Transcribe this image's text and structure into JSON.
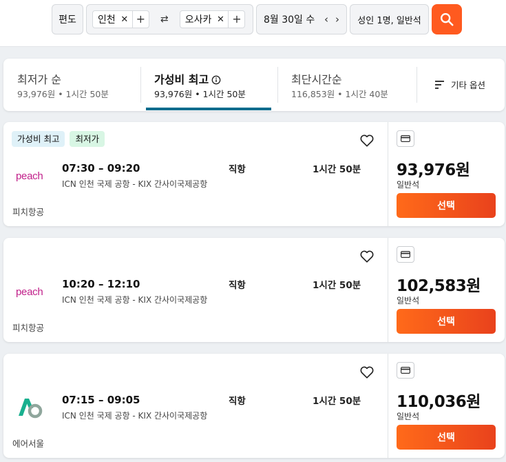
{
  "search": {
    "trip_type": "편도",
    "origin": "인천",
    "destination": "오사카",
    "remove_glyph": "✕",
    "add_glyph": "+",
    "swap_glyph": "⇄",
    "date": "8월 30일 수",
    "prev_glyph": "‹",
    "next_glyph": "›",
    "passengers": "성인 1명, 일반석",
    "accent_color": "#ff5a1f"
  },
  "sort_tabs": [
    {
      "title": "최저가 순",
      "subtitle": "93,976원 • 1시간 50분",
      "active": false
    },
    {
      "title": "가성비 최고",
      "subtitle": "93,976원 • 1시간 50분",
      "active": true
    },
    {
      "title": "최단시간순",
      "subtitle": "116,853원 • 1시간 40분",
      "active": false
    }
  ],
  "other_options": {
    "label": "기타 옵션",
    "icon": "sort-lines-icon"
  },
  "flights": [
    {
      "badges": [
        "가성비 최고",
        "최저가"
      ],
      "airline_logo": "peach",
      "times": "07:30 – 09:20",
      "route": "ICN 인천 국제 공항 - KIX 간사이국제공항",
      "stops": "직항",
      "duration": "1시간 50분",
      "airline": "피치항공",
      "price": "93,976원",
      "cabin": "일반석",
      "select_label": "선택"
    },
    {
      "badges": [],
      "airline_logo": "peach",
      "times": "10:20 – 12:10",
      "route": "ICN 인천 국제 공항 - KIX 간사이국제공항",
      "stops": "직항",
      "duration": "1시간 50분",
      "airline": "피치항공",
      "price": "102,583원",
      "cabin": "일반석",
      "select_label": "선택"
    },
    {
      "badges": [],
      "airline_logo": "air-seoul-logo",
      "times": "07:15 – 09:05",
      "route": "ICN 인천 국제 공항 - KIX 간사이국제공항",
      "stops": "직항",
      "duration": "1시간 50분",
      "airline": "에어서울",
      "price": "110,036원",
      "cabin": "일반석",
      "select_label": "선택"
    }
  ]
}
